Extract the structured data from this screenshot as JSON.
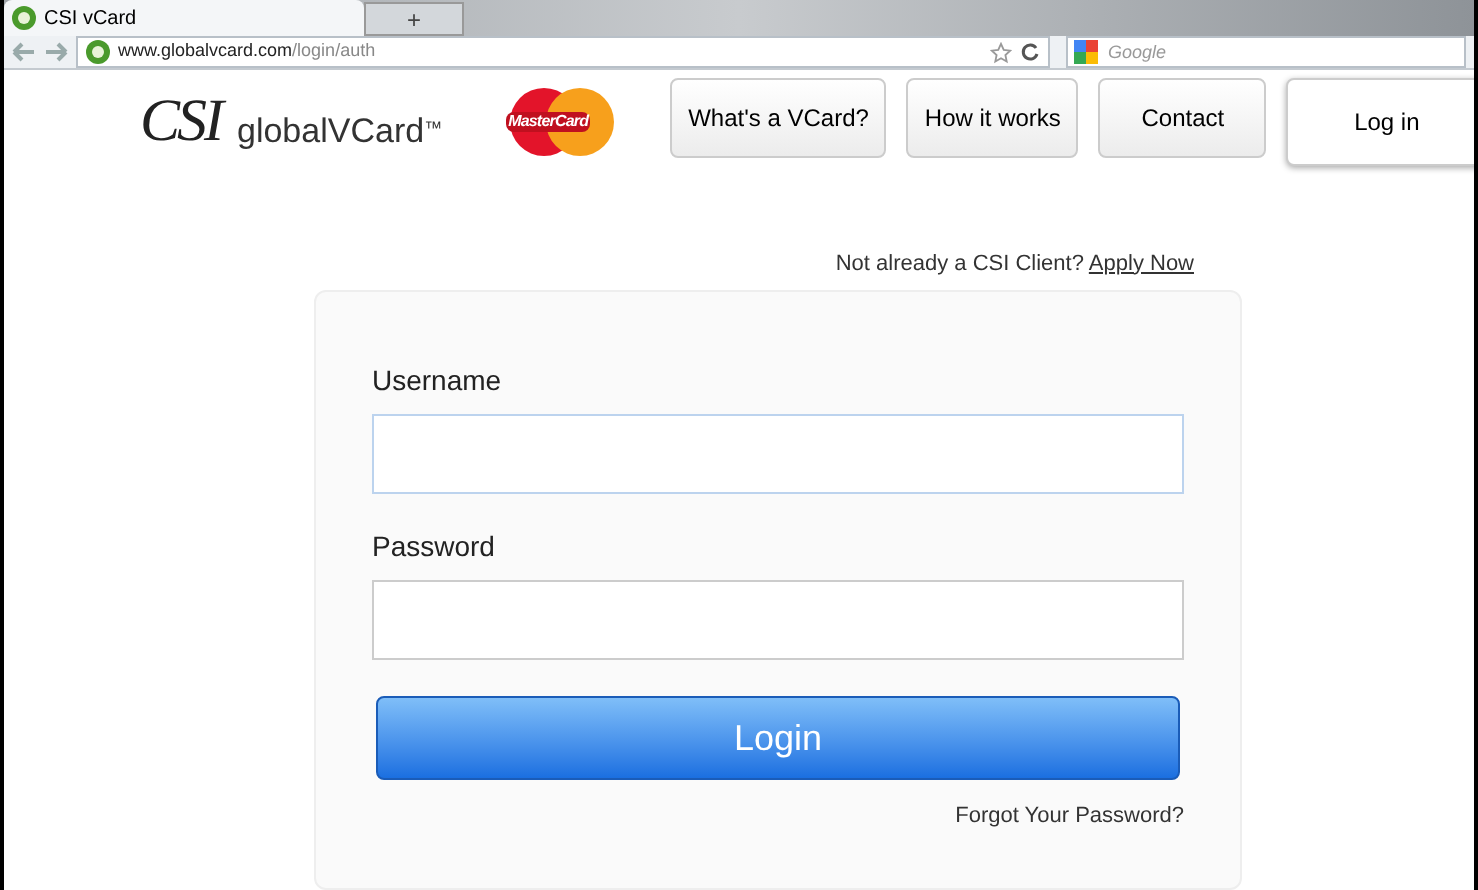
{
  "browser": {
    "tab": {
      "title": "CSI vCard"
    },
    "new_tab": "+",
    "url": {
      "host": "www.globalvcard.com",
      "path": "/login/auth"
    },
    "search": {
      "placeholder": "Google"
    }
  },
  "header": {
    "logo": {
      "mark": "CSI",
      "name": "globalVCard",
      "tm": "™"
    },
    "card_brand": "MasterCard",
    "nav": [
      {
        "label": "What's a VCard?",
        "selected": false
      },
      {
        "label": "How it works",
        "selected": false
      },
      {
        "label": "Contact",
        "selected": false
      },
      {
        "label": "Log in",
        "selected": true
      }
    ]
  },
  "signup": {
    "text": "Not already a CSI Client?",
    "link": "Apply Now"
  },
  "form": {
    "fields": [
      {
        "label": "Username",
        "focused": true
      },
      {
        "label": "Password",
        "focused": false
      }
    ],
    "submit": "Login",
    "forgot": "Forgot Your Password?"
  }
}
